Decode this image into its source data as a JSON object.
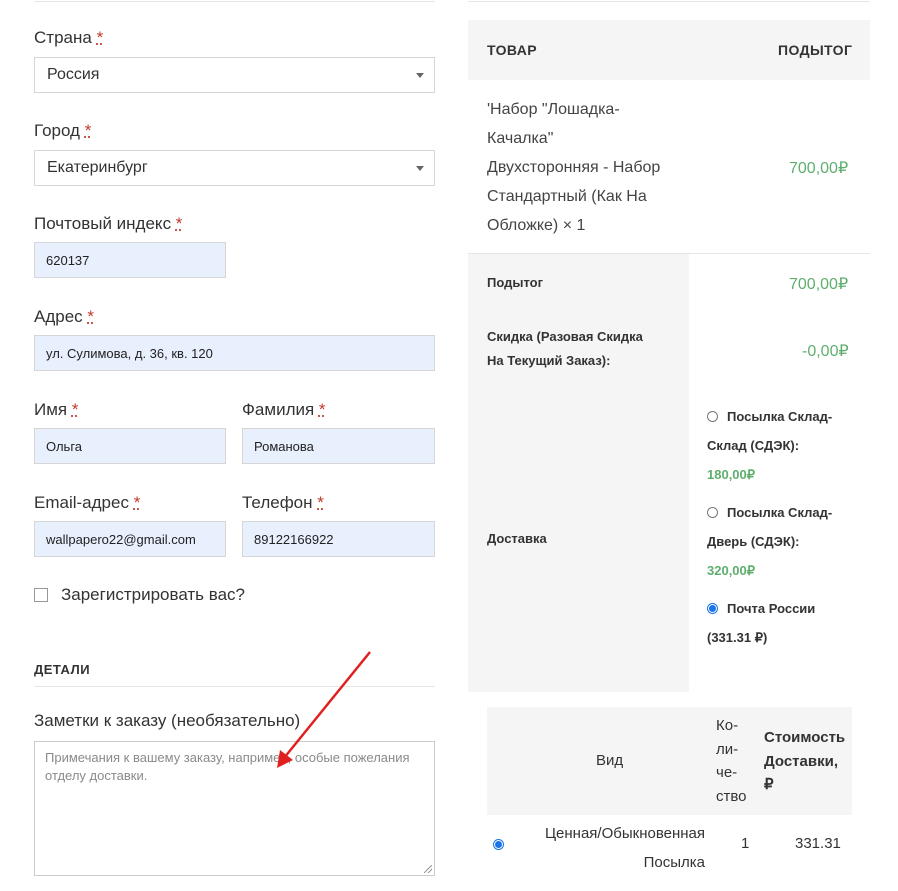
{
  "form": {
    "country": {
      "label": "Страна",
      "value": "Россия"
    },
    "city": {
      "label": "Город",
      "value": "Екатеринбург"
    },
    "postcode": {
      "label": "Почтовый индекс",
      "value": "620137"
    },
    "address": {
      "label": "Адрес",
      "value": "ул. Сулимова, д. 36, кв. 120"
    },
    "first_name": {
      "label": "Имя",
      "value": "Ольга"
    },
    "last_name": {
      "label": "Фамилия",
      "value": "Романова"
    },
    "email": {
      "label": "Email-адрес",
      "value": "wallpapero22@gmail.com"
    },
    "phone": {
      "label": "Телефон",
      "value": "89122166922"
    },
    "required_mark": "*",
    "register_label": "Зарегистрировать вас?",
    "details_title": "ДЕТАЛИ",
    "notes": {
      "label": "Заметки к заказу (необязательно)",
      "placeholder": "Примечания к вашему заказу, например, особые пожелания отделу доставки."
    }
  },
  "order": {
    "col_product": "ТОВАР",
    "col_subtotal": "ПОДЫТОГ",
    "product_lines": [
      "'Набор \"Лошадка-",
      "Качалка\"",
      "Двухсторонняя - Набор",
      "Стандартный (Как На",
      "Обложке)"
    ],
    "product_qty": "× 1",
    "product_price": "700,00₽",
    "subtotal_label": "Подытог",
    "subtotal_value": "700,00₽",
    "discount_label_1": "Скидка (Разовая Скидка",
    "discount_label_2": "На Текущий Заказ):",
    "discount_value": "-0,00₽",
    "shipping_label": "Доставка",
    "shipping_options": [
      {
        "line1": "Посылка Склад-",
        "line2": "Склад (СДЭК):",
        "price": "180,00₽",
        "selected": false
      },
      {
        "line1": "Посылка Склад-",
        "line2": "Дверь (СДЭК):",
        "price": "320,00₽",
        "selected": false
      },
      {
        "line1": "Почта России",
        "line2": "(331.31 ₽)",
        "price": "",
        "selected": true
      }
    ],
    "post_table": {
      "col_type": "Вид",
      "col_qty": [
        "Ко-",
        "ли-",
        "че-",
        "ство"
      ],
      "col_cost": [
        "Стоимость",
        "Доставки,",
        "₽"
      ],
      "row": {
        "type_1": "Ценная/Обыкновенная",
        "type_2": "Посылка",
        "qty": "1",
        "cost": "331.31"
      }
    }
  },
  "colors": {
    "accent_green": "#5fae6e",
    "required_red": "#c0392b",
    "radio_blue": "#1a73e8",
    "autofill_bg": "#e8effd"
  }
}
